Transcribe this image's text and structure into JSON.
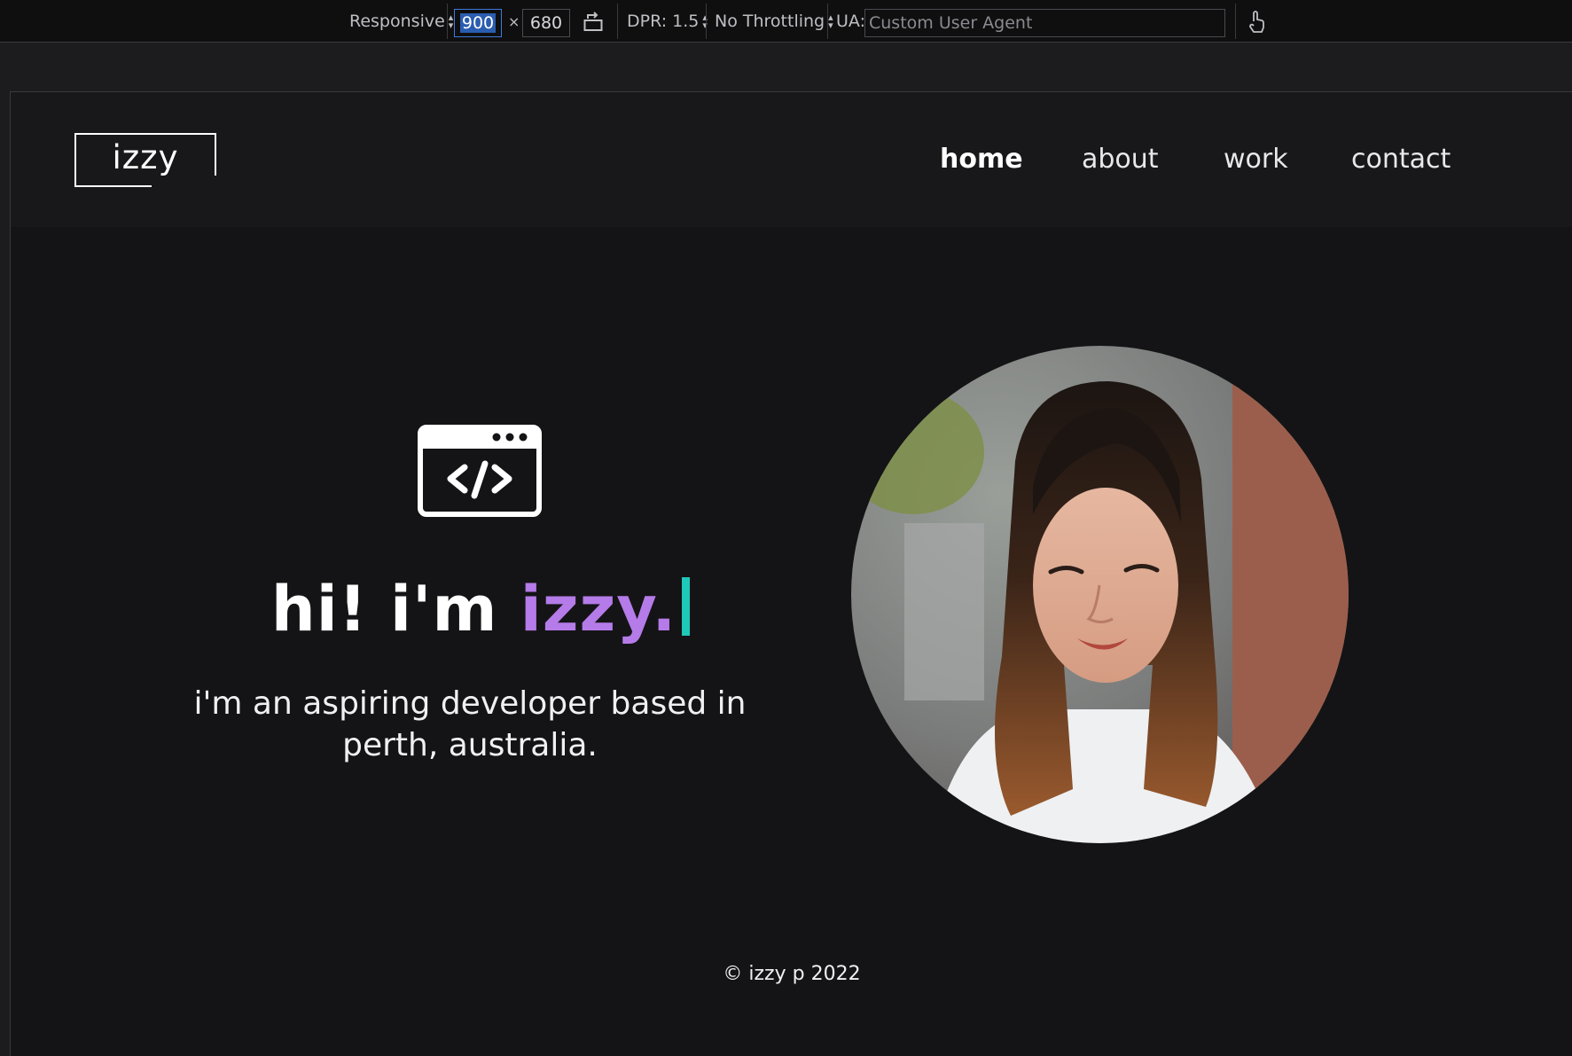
{
  "devtools": {
    "device_mode": "Responsive",
    "width": "900",
    "times": "×",
    "height": "680",
    "dpr": "DPR: 1.5",
    "throttling": "No Throttling",
    "ua_label": "UA:",
    "ua_placeholder": "Custom User Agent"
  },
  "site": {
    "logo": "izzy",
    "nav": [
      {
        "label": "home",
        "active": true
      },
      {
        "label": "about",
        "active": false
      },
      {
        "label": "work",
        "active": false
      },
      {
        "label": "contact",
        "active": false
      }
    ],
    "hero": {
      "greeting": "hi! i'm ",
      "name": "izzy.",
      "tagline_line1": "i'm an aspiring developer based in",
      "tagline_line2": "perth, australia."
    },
    "footer": "© izzy p 2022"
  },
  "colors": {
    "accent_purple": "#b57be8",
    "cursor_teal": "#1ec9b7",
    "background": "#141416"
  }
}
